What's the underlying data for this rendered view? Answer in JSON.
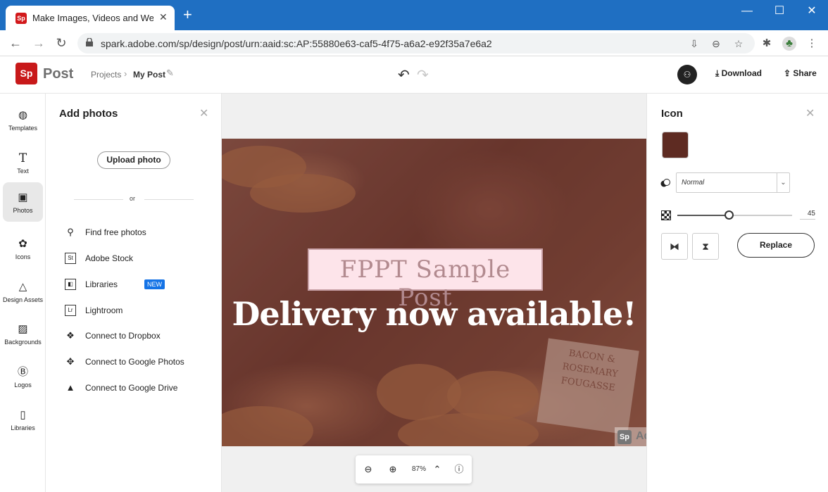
{
  "browser": {
    "tab_title": "Make Images, Videos and Web St",
    "tab_favicon": "Sp",
    "url": "spark.adobe.com/sp/design/post/urn:aaid:sc:AP:55880e63-caf5-4f75-a6a2-e92f35a7e6a2",
    "icons": [
      "back-icon",
      "forward-icon",
      "reload-icon",
      "lock-icon",
      "install-icon",
      "zoom-out-icon",
      "star-icon",
      "extensions-icon",
      "profile-icon",
      "menu-icon"
    ]
  },
  "app": {
    "logo": "Sp",
    "name": "Post",
    "breadcrumb": {
      "projects": "Projects",
      "separator": "›",
      "current": "My Post"
    },
    "download_label": "Download",
    "share_label": "Share",
    "accent_color": "#c8191a"
  },
  "rail": {
    "items": [
      {
        "label": "Templates",
        "icon": "templates-icon"
      },
      {
        "label": "Text",
        "icon": "text-icon"
      },
      {
        "label": "Photos",
        "icon": "photos-icon",
        "active": true
      },
      {
        "label": "Icons",
        "icon": "icons-icon"
      },
      {
        "label": "Design Assets",
        "icon": "design-assets-icon"
      },
      {
        "label": "Backgrounds",
        "icon": "backgrounds-icon"
      },
      {
        "label": "Logos",
        "icon": "logos-icon"
      },
      {
        "label": "Libraries",
        "icon": "libraries-icon"
      }
    ]
  },
  "photos_panel": {
    "title": "Add photos",
    "upload_label": "Upload photo",
    "or_label": "or",
    "sources": [
      {
        "label": "Find free photos",
        "icon": "search-icon"
      },
      {
        "label": "Adobe Stock",
        "icon": "adobe-stock-icon",
        "glyph": "St"
      },
      {
        "label": "Libraries",
        "icon": "libraries-icon",
        "badge": "NEW"
      },
      {
        "label": "Lightroom",
        "icon": "lightroom-icon",
        "glyph": "Lr"
      },
      {
        "label": "Connect to Dropbox",
        "icon": "dropbox-icon"
      },
      {
        "label": "Connect to Google Photos",
        "icon": "google-photos-icon"
      },
      {
        "label": "Connect to Google Drive",
        "icon": "google-drive-icon"
      }
    ]
  },
  "canvas": {
    "title_text": "FPPT Sample Post",
    "headline": "Delivery now available!",
    "sign_text": "BACON & ROSEMARY FOUGASSE",
    "watermark_logo": "Sp",
    "watermark_text": "Ad",
    "zoom": "87%"
  },
  "icon_panel": {
    "title": "Icon",
    "color": "#5e2b22",
    "blend_mode": "Normal",
    "opacity": 45,
    "replace_label": "Replace"
  }
}
